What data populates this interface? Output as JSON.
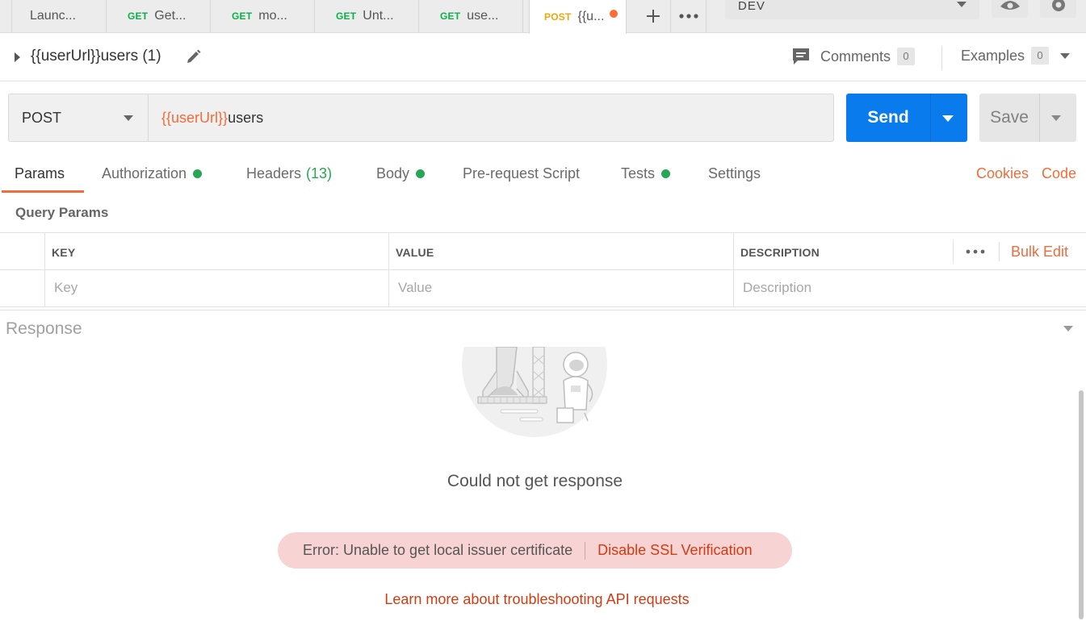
{
  "tabs": [
    {
      "method": "",
      "label": "Launc..."
    },
    {
      "method": "GET",
      "label": "Get..."
    },
    {
      "method": "GET",
      "label": "mo..."
    },
    {
      "method": "GET",
      "label": "Unt..."
    },
    {
      "method": "GET",
      "label": "use..."
    },
    {
      "method": "POST",
      "label": "{{u..."
    }
  ],
  "environment": {
    "selected": "DEV"
  },
  "request": {
    "name": "{{userUrl}}users (1)",
    "method": "POST",
    "url_variable": "{{userUrl}}",
    "url_path": "users"
  },
  "header_actions": {
    "comments_label": "Comments",
    "comments_count": "0",
    "examples_label": "Examples",
    "examples_count": "0"
  },
  "buttons": {
    "send": "Send",
    "save": "Save"
  },
  "subtabs": [
    {
      "label": "Params"
    },
    {
      "label": "Authorization"
    },
    {
      "label": "Headers",
      "count": "(13)"
    },
    {
      "label": "Body"
    },
    {
      "label": "Pre-request Script"
    },
    {
      "label": "Tests"
    },
    {
      "label": "Settings"
    }
  ],
  "links": {
    "cookies": "Cookies",
    "code": "Code"
  },
  "query_params": {
    "title": "Query Params",
    "columns": [
      "KEY",
      "VALUE",
      "DESCRIPTION"
    ],
    "placeholders": [
      "Key",
      "Value",
      "Description"
    ],
    "bulk_edit": "Bulk Edit"
  },
  "response": {
    "title": "Response",
    "message": "Could not get response",
    "error_text": "Error: Unable to get local issuer certificate",
    "error_action": "Disable SSL Verification",
    "learn_more": "Learn more about troubleshooting API requests"
  },
  "colors": {
    "accent": "#f26b3a",
    "send_blue": "#097bed",
    "get_green": "#0cb04a",
    "post_yellow": "#f2a50a",
    "status_green": "#26a753",
    "error_bg": "#f8d3d3",
    "error_text": "#d23b12"
  }
}
